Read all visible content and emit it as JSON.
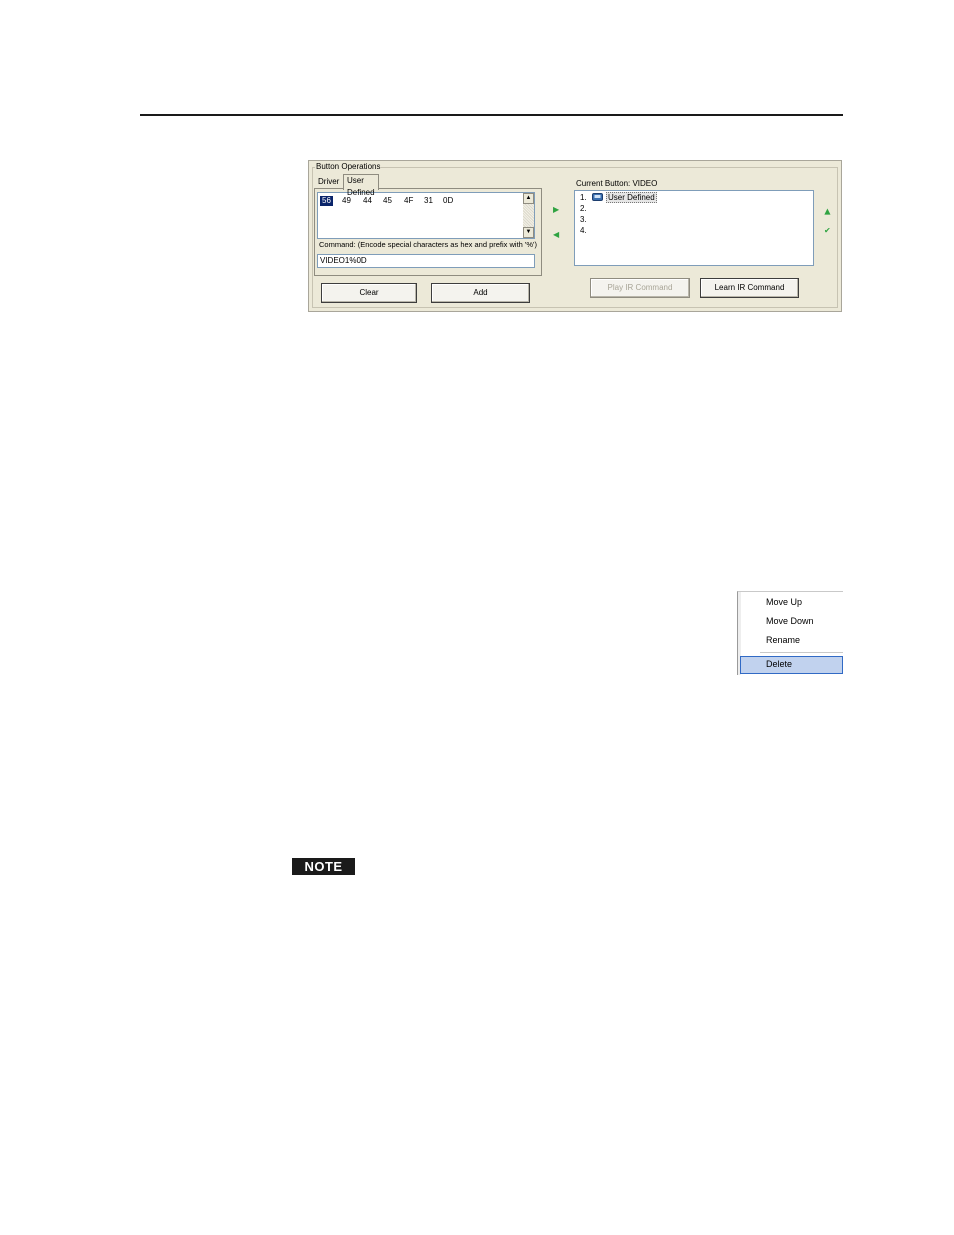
{
  "panel": {
    "title": "Button Operations",
    "tabs": [
      "Driver",
      "User Defined"
    ],
    "active_tab": "User Defined",
    "hex_bytes": [
      "56",
      "49",
      "44",
      "45",
      "4F",
      "31",
      "0D"
    ],
    "selected_byte_index": 0,
    "command_label": "Command:  (Encode special characters as hex and prefix with '%')",
    "command_value": "VIDEO1%0D",
    "current_button_label": "Current Button: VIDEO",
    "slots": [
      {
        "number": "1.",
        "name": "User Defined"
      },
      {
        "number": "2.",
        "name": ""
      },
      {
        "number": "3.",
        "name": ""
      },
      {
        "number": "4.",
        "name": ""
      }
    ],
    "buttons": {
      "clear": "Clear",
      "add": "Add",
      "play_ir": "Play IR Command",
      "learn_ir": "Learn IR Command"
    },
    "icons": [
      "add-right-arrow-icon",
      "remove-left-arrow-icon",
      "move-up-arrow-icon",
      "move-down-arrow-icon",
      "scroll-up-icon",
      "scroll-down-icon",
      "command-icon"
    ],
    "colors": {
      "arrow": "#2fa341",
      "selection": "#0a246a"
    }
  },
  "context_menu": {
    "items": [
      "Move Up",
      "Move Down",
      "Rename",
      "Delete"
    ],
    "highlighted": "Delete"
  },
  "note": {
    "label": "NOTE"
  }
}
